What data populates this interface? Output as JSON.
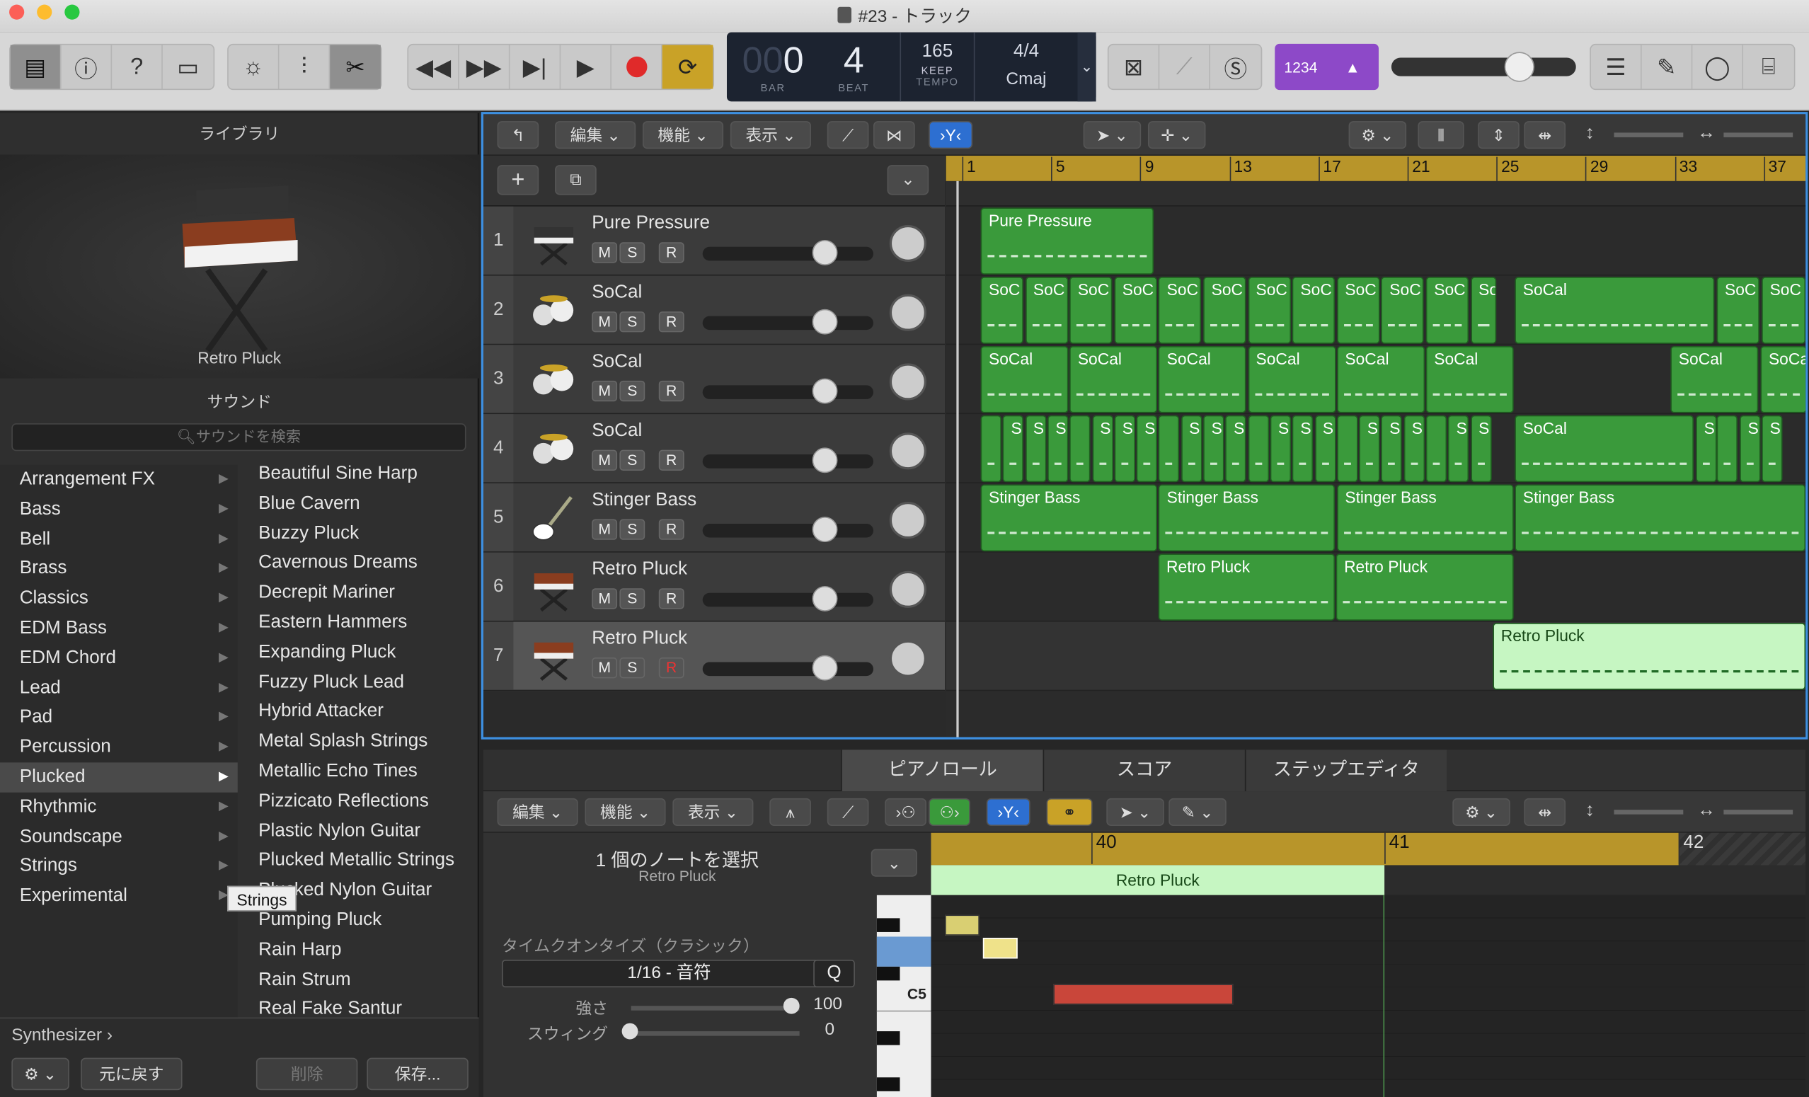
{
  "window": {
    "title": "#23 - トラック"
  },
  "lcd": {
    "bar": "0",
    "beat": "4",
    "bar_label": "BAR",
    "beat_label": "BEAT",
    "tempo": "165",
    "keep": "KEEP",
    "tempo_label": "TEMPO",
    "signature": "4/4",
    "key": "Cmaj"
  },
  "modes": {
    "count_in": "1234"
  },
  "library": {
    "header": "ライブラリ",
    "selected_patch": "Retro Pluck",
    "sound_header": "サウンド",
    "search_placeholder": "サウンドを検索",
    "categories": [
      "Arrangement FX",
      "Bass",
      "Bell",
      "Brass",
      "Classics",
      "EDM Bass",
      "EDM Chord",
      "Lead",
      "Pad",
      "Percussion",
      "Plucked",
      "Rhythmic",
      "Soundscape",
      "Strings",
      "Experimental"
    ],
    "patches": [
      "Beautiful Sine Harp",
      "Blue Cavern",
      "Buzzy Pluck",
      "Cavernous Dreams",
      "Decrepit Mariner",
      "Eastern Hammers",
      "Expanding Pluck",
      "Fuzzy Pluck Lead",
      "Hybrid Attacker",
      "Metal Splash Strings",
      "Metallic Echo Tines",
      "Pizzicato Reflections",
      "Plastic Nylon Guitar",
      "Plucked Metallic Strings",
      "Plucked Nylon Guitar",
      "Pumping Pluck",
      "Rain Harp",
      "Rain Strum",
      "Real Fake Santur"
    ],
    "tooltip": "Strings",
    "breadcrumb": "Synthesizer",
    "revert": "元に戻す",
    "delete": "削除",
    "save": "保存..."
  },
  "tracks_toolbar": {
    "edit": "編集",
    "functions": "機能",
    "view": "表示"
  },
  "ruler": [
    "1",
    "5",
    "9",
    "13",
    "17",
    "21",
    "25",
    "29",
    "33",
    "37"
  ],
  "tracks": [
    {
      "num": "1",
      "name": "Pure Pressure"
    },
    {
      "num": "2",
      "name": "SoCal"
    },
    {
      "num": "3",
      "name": "SoCal"
    },
    {
      "num": "4",
      "name": "SoCal"
    },
    {
      "num": "5",
      "name": "Stinger Bass"
    },
    {
      "num": "6",
      "name": "Retro Pluck"
    },
    {
      "num": "7",
      "name": "Retro Pluck"
    }
  ],
  "track_buttons": {
    "mute": "M",
    "solo": "S",
    "record": "R"
  },
  "regions": {
    "r1": "Pure Pressure",
    "r2_short": "SoC",
    "r2_tiny": "So",
    "r2_long": "SoCal",
    "r3": "SoCal",
    "r3_cut": "SoCa",
    "r4_short": "S",
    "r4_long": "SoCal",
    "r5": "Stinger Bass",
    "r6": "Retro Pluck",
    "r7": "Retro Pluck"
  },
  "editor": {
    "tabs": [
      "ピアノロール",
      "スコア",
      "ステップエディタ"
    ],
    "edit": "編集",
    "functions": "機能",
    "view": "表示",
    "selection": "1 個のノートを選択",
    "region_name": "Retro Pluck",
    "quantize_label": "タイムクオンタイズ（クラシック）",
    "quantize_value": "1/16 - 音符",
    "q_button": "Q",
    "strength_label": "強さ",
    "strength_value": "100",
    "swing_label": "スウィング",
    "swing_value": "0",
    "ruler": [
      "40",
      "41",
      "42"
    ],
    "key_label": "C5"
  },
  "colors": {
    "region_green": "#3a9a3b",
    "region_selected": "#c6f6c2",
    "ruler_gold": "#b8952a",
    "accent_blue": "#2d6fd1",
    "modes_purple": "#8d49c8",
    "note_red": "#c9463a",
    "note_yellow": "#e8dc7a"
  }
}
